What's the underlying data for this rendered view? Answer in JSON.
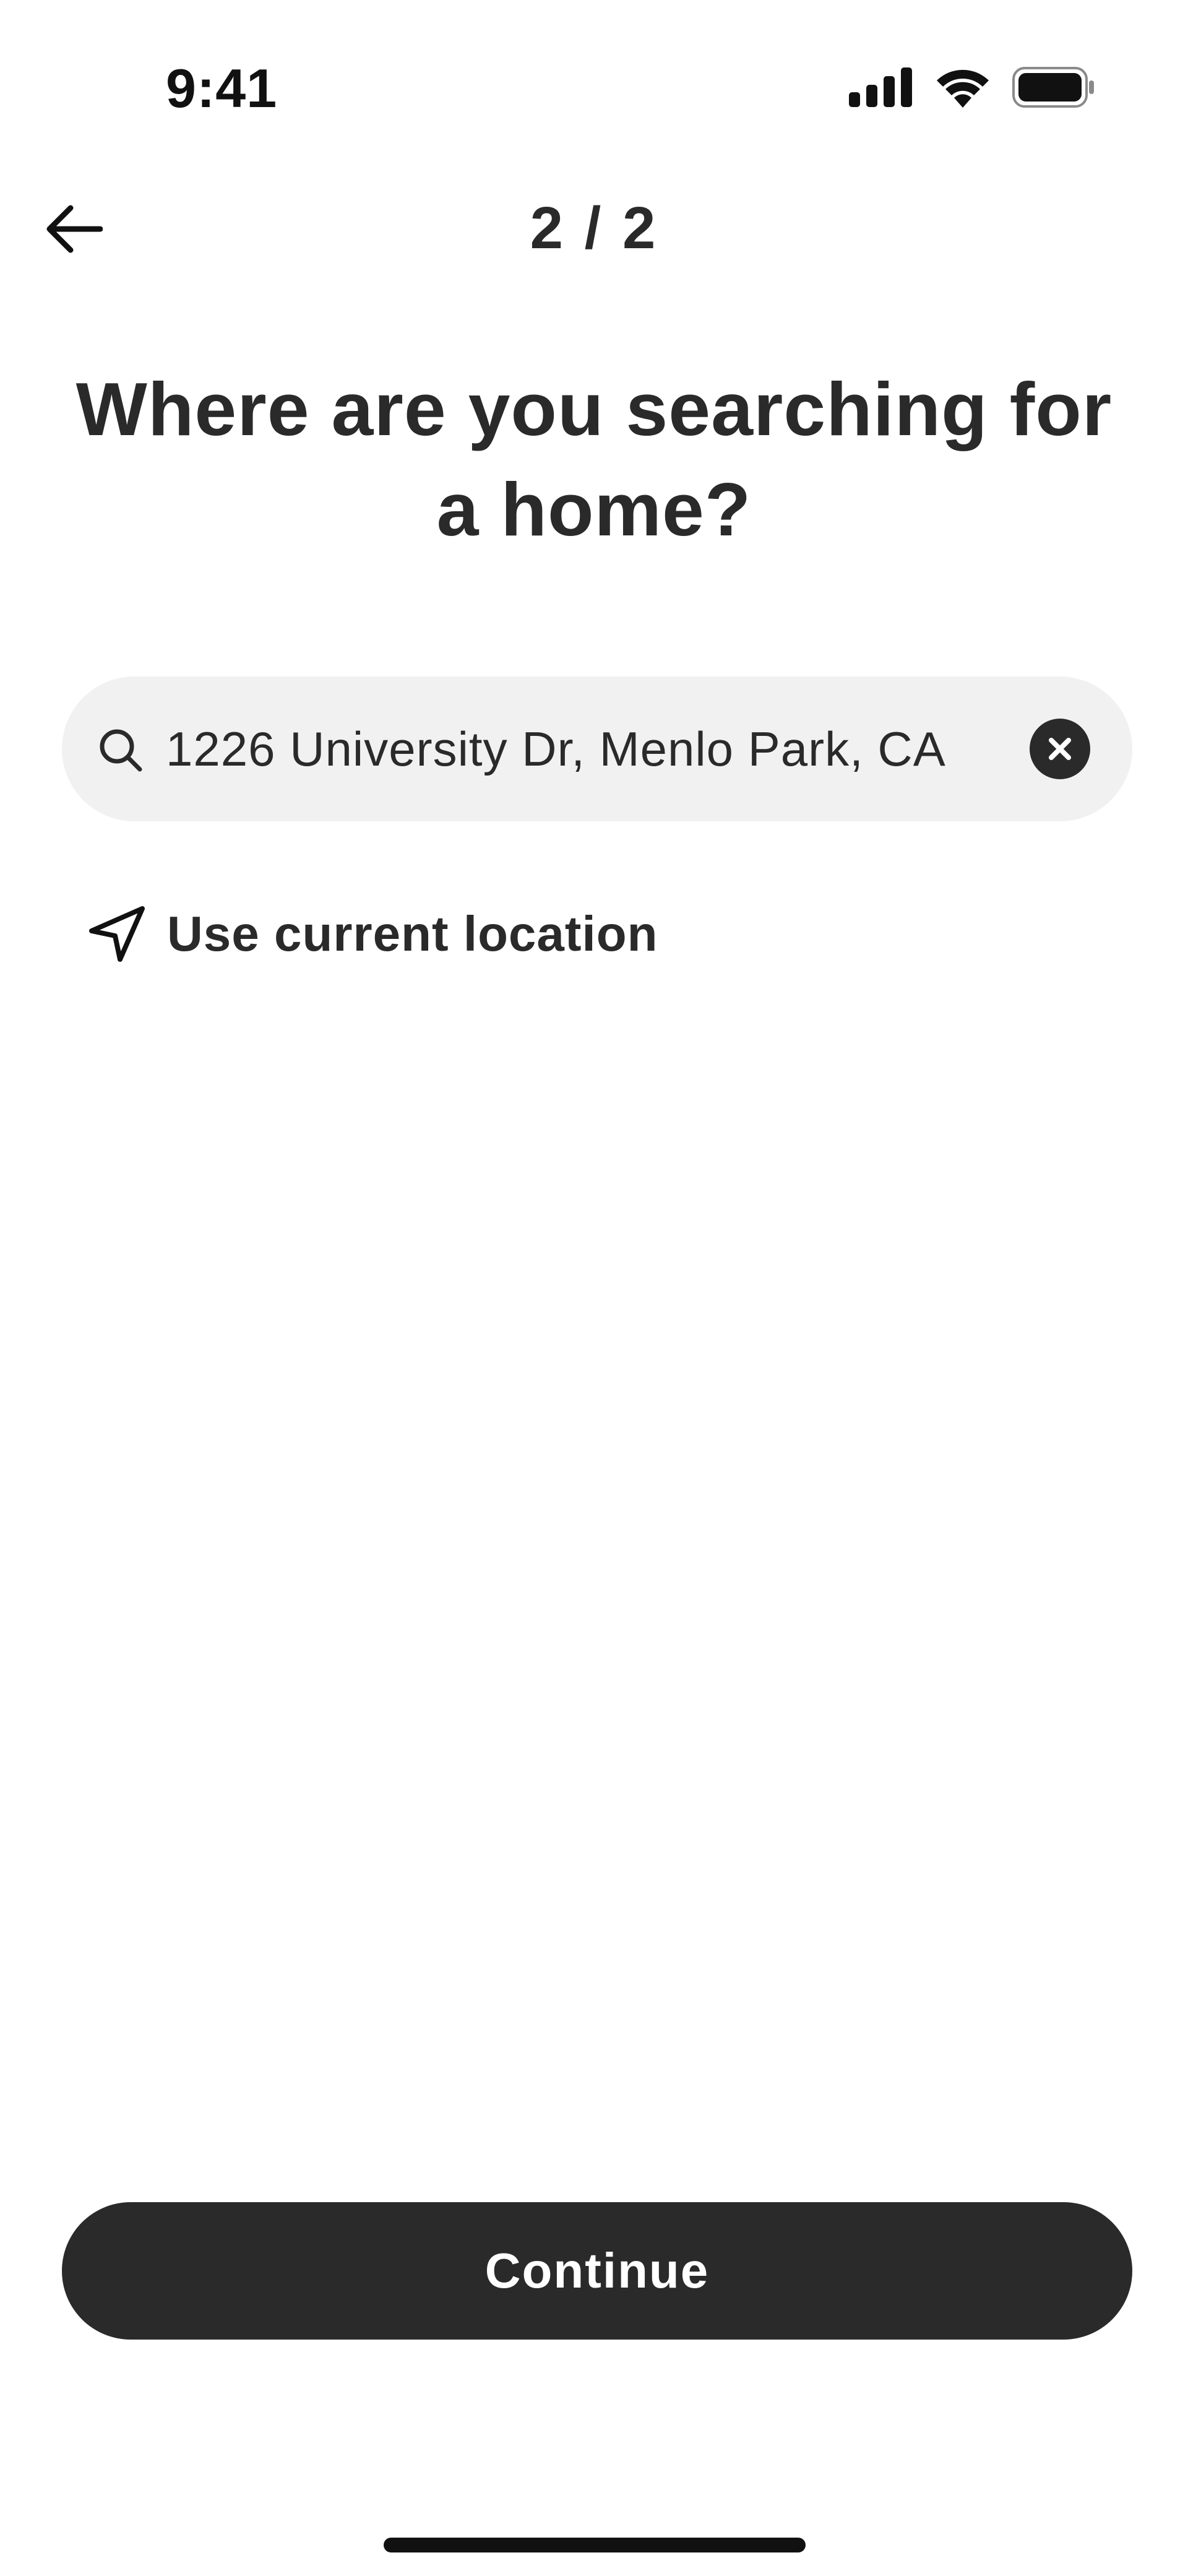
{
  "status_bar": {
    "time": "9:41",
    "icons": [
      "signal-icon",
      "wifi-icon",
      "battery-icon"
    ]
  },
  "nav": {
    "back_icon": "arrow-left-icon",
    "step": "2 / 2"
  },
  "heading": {
    "line1": "Where are you searching for",
    "line2": "a home?"
  },
  "search": {
    "icon": "search-icon",
    "value": "1226 University Dr, Menlo Park, CA",
    "clear_icon": "close-icon"
  },
  "current_location": {
    "icon": "navigation-arrow-icon",
    "label": "Use current location"
  },
  "continue_button": {
    "label": "Continue"
  },
  "colors": {
    "primary": "#2a2a2a",
    "field_bg": "#f1f1f1",
    "background": "#ffffff"
  }
}
